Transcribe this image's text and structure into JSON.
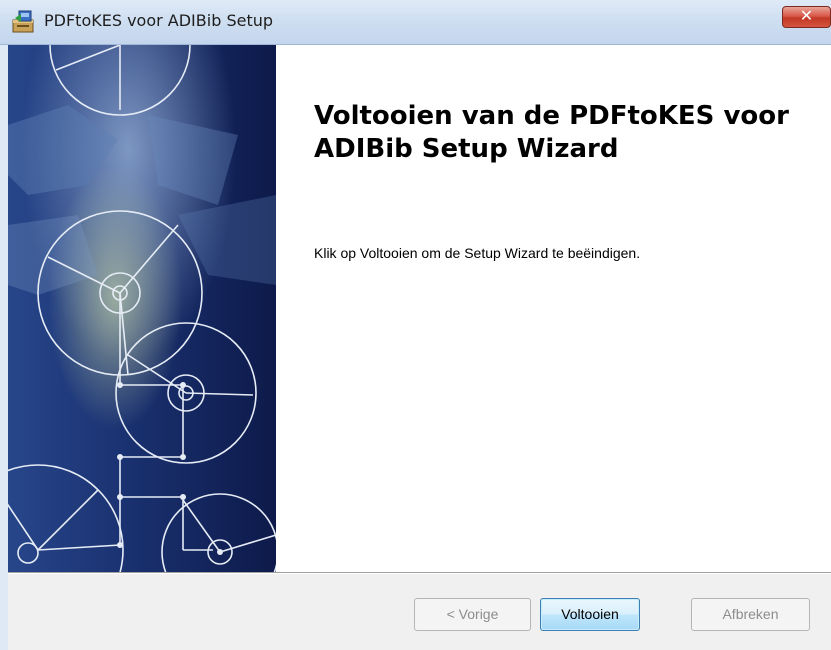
{
  "window": {
    "title": "PDFtoKES voor ADIBib Setup",
    "close_label": "✕"
  },
  "main": {
    "heading": "Voltooien van de PDFtoKES voor ADIBib Setup Wizard",
    "description": "Klik op Voltooien om de Setup Wizard te beëindigen."
  },
  "buttons": {
    "back": "< Vorige",
    "finish": "Voltooien",
    "cancel": "Afbreken"
  },
  "icons": {
    "app": "installer-package-icon",
    "close": "close-icon"
  },
  "colors": {
    "banner_dark": "#0d1a4a",
    "banner_light": "#4a79b8",
    "close_red": "#c23a27",
    "default_button_border": "#3c7fb1"
  }
}
